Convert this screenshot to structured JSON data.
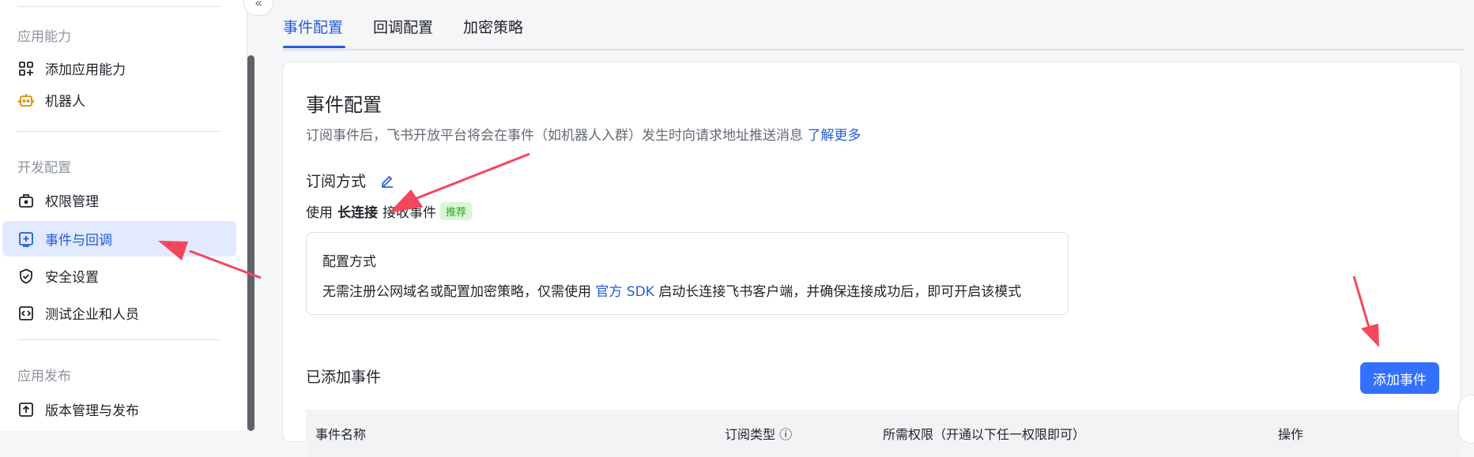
{
  "sidebar": {
    "sections": [
      {
        "title": "应用能力",
        "items": [
          {
            "label": "添加应用能力",
            "icon": "grid-plus-icon"
          },
          {
            "label": "机器人",
            "icon": "robot-icon"
          }
        ]
      },
      {
        "title": "开发配置",
        "items": [
          {
            "label": "权限管理",
            "icon": "briefcase-lock-icon"
          },
          {
            "label": "事件与回调",
            "icon": "event-plus-icon",
            "active": true
          },
          {
            "label": "安全设置",
            "icon": "shield-check-icon"
          },
          {
            "label": "测试企业和人员",
            "icon": "code-box-icon"
          }
        ]
      },
      {
        "title": "应用发布",
        "items": [
          {
            "label": "版本管理与发布",
            "icon": "upload-box-icon"
          }
        ]
      }
    ],
    "collapse_icon": "double-chevron-left-icon",
    "collapse_symbol": "«"
  },
  "tabs": [
    {
      "label": "事件配置",
      "active": true
    },
    {
      "label": "回调配置"
    },
    {
      "label": "加密策略"
    }
  ],
  "card": {
    "title": "事件配置",
    "description": "订阅事件后，飞书开放平台将会在事件（如机器人入群）发生时向请求地址推送消息",
    "learn_more": "了解更多",
    "subscribe_title": "订阅方式",
    "mode_prefix": "使用",
    "mode_bold": "长连接",
    "mode_suffix": "接收事件",
    "badge": "推荐",
    "config_box": {
      "title": "配置方式",
      "text_before": "无需注册公网域名或配置加密策略，仅需使用",
      "link": "官方 SDK",
      "text_after": "启动长连接飞书客户端，并确保连接成功后，即可开启该模式"
    },
    "added_events_title": "已添加事件",
    "add_button": "添加事件",
    "table_headers": [
      "事件名称",
      "订阅类型 ⓘ",
      "所需权限（开通以下任一权限即可）",
      "操作"
    ]
  },
  "colors": {
    "accent": "#245bdb",
    "primary_button": "#3370ff",
    "active_nav_bg": "#e1eaff",
    "badge_bg": "#d9f5d6",
    "badge_text": "#2ea121",
    "annotation_arrow": "#f5475c"
  }
}
